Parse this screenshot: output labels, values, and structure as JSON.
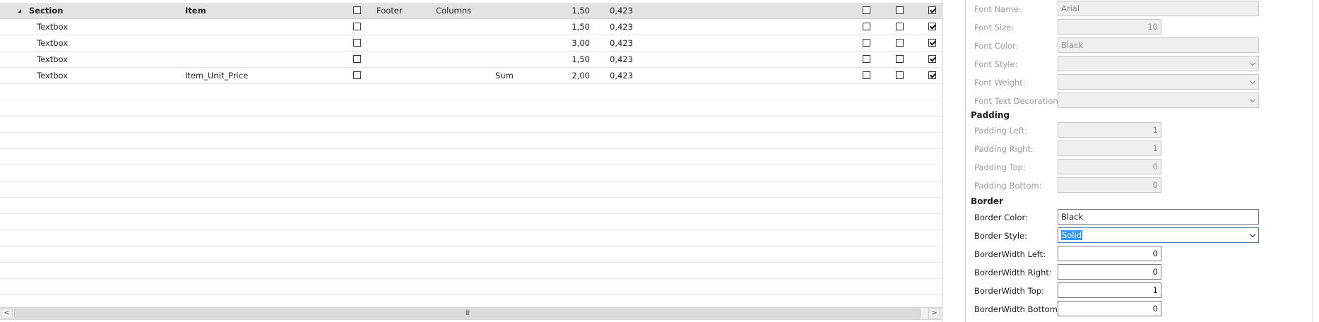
{
  "grid": {
    "header": {
      "section": "Section",
      "item": "Item",
      "footer": "Footer",
      "columns": "Columns",
      "width": "1,50",
      "height": "0,423",
      "checks": [
        false,
        false,
        false,
        true
      ]
    },
    "rows": [
      {
        "section": "Textbox",
        "item": "",
        "agg": "",
        "width": "1,50",
        "height": "0,423",
        "checks": [
          false,
          false,
          false,
          true
        ]
      },
      {
        "section": "Textbox",
        "item": "",
        "agg": "",
        "width": "3,00",
        "height": "0,423",
        "checks": [
          false,
          false,
          false,
          true
        ]
      },
      {
        "section": "Textbox",
        "item": "",
        "agg": "",
        "width": "1,50",
        "height": "0,423",
        "checks": [
          false,
          false,
          false,
          true
        ]
      },
      {
        "section": "Textbox",
        "item": "Item_Unit_Price",
        "agg": "Sum",
        "width": "2,00",
        "height": "0,423",
        "checks": [
          false,
          false,
          false,
          true
        ]
      }
    ],
    "scrollbar": {
      "left_arrow": "<",
      "right_arrow": ">",
      "grip": "III"
    }
  },
  "panel": {
    "font_name": {
      "label": "Font Name:",
      "value": "Arial"
    },
    "font_size": {
      "label": "Font Size:",
      "value": "10"
    },
    "font_color": {
      "label": "Font Color:",
      "value": "Black"
    },
    "font_style": {
      "label": "Font Style:",
      "value": ""
    },
    "font_weight": {
      "label": "Font Weight:",
      "value": ""
    },
    "font_text_decoration": {
      "label": "Font Text Decoration:",
      "value": ""
    },
    "padding_title": "Padding",
    "padding_left": {
      "label": "Padding Left:",
      "value": "1"
    },
    "padding_right": {
      "label": "Padding Right:",
      "value": "1"
    },
    "padding_top": {
      "label": "Padding Top:",
      "value": "0"
    },
    "padding_bottom": {
      "label": "Padding Bottom:",
      "value": "0"
    },
    "border_title": "Border",
    "border_color": {
      "label": "Border Color:",
      "value": "Black"
    },
    "border_style": {
      "label": "Border Style:",
      "value": "Solid"
    },
    "borderwidth_left": {
      "label": "BorderWidth Left:",
      "value": "0"
    },
    "borderwidth_right": {
      "label": "BorderWidth Right:",
      "value": "0"
    },
    "borderwidth_top": {
      "label": "BorderWidth Top:",
      "value": "1"
    },
    "borderwidth_bottom": {
      "label": "BorderWidth Bottom:",
      "value": "0"
    }
  }
}
